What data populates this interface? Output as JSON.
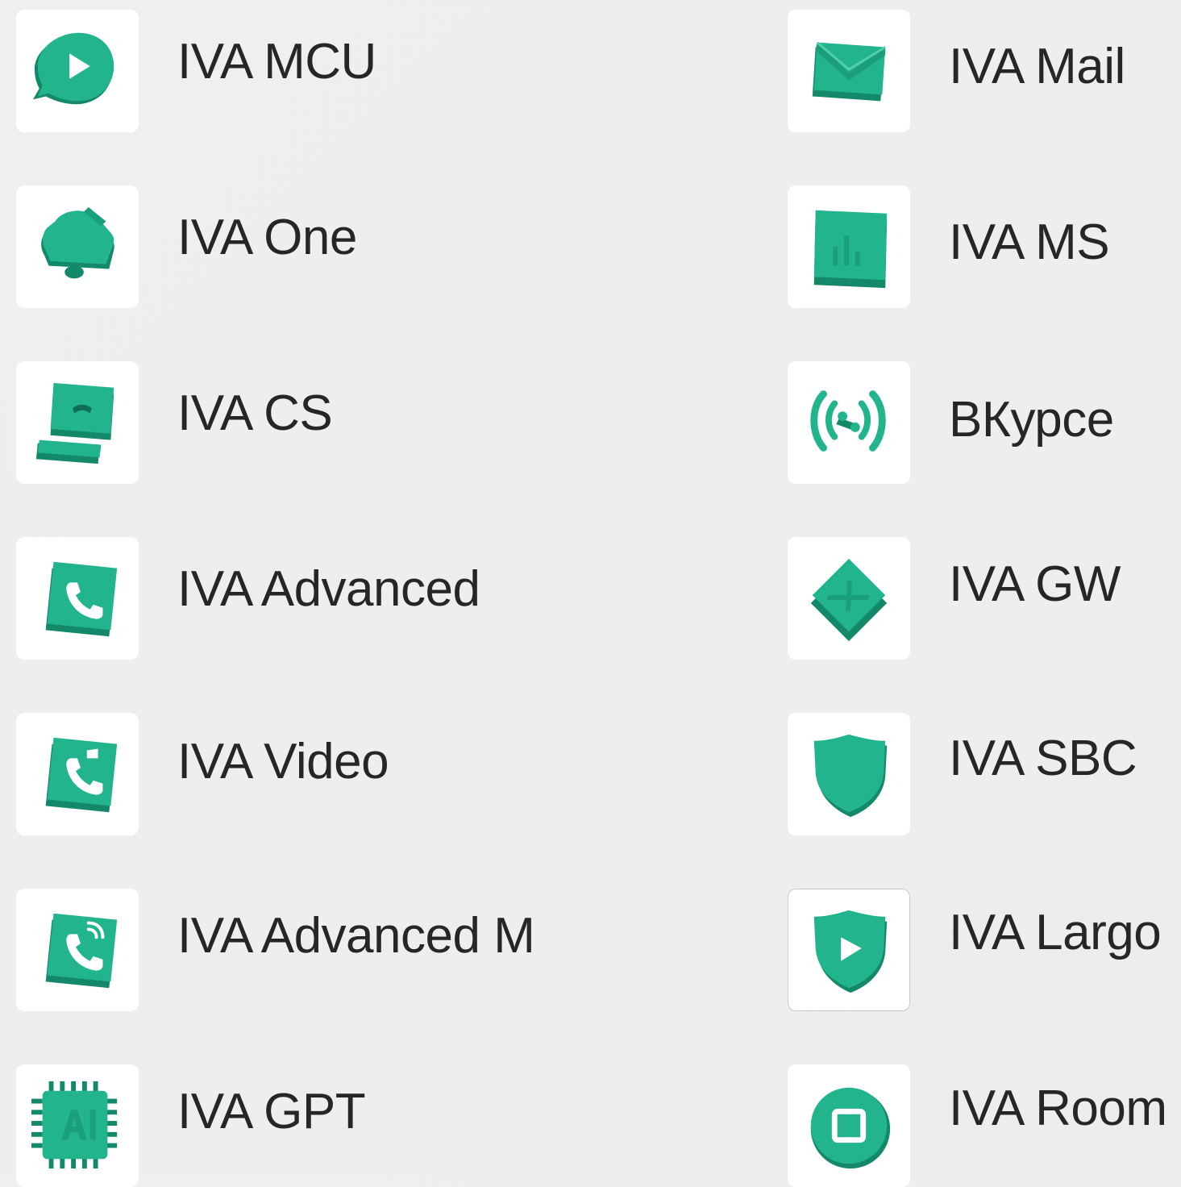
{
  "accent_color": "#22b48c",
  "accent_dark": "#14896a",
  "tile_color": "#ffffff",
  "text_color": "#262626",
  "products": [
    {
      "id": "mcu",
      "label": "IVA MCU",
      "icon": "chat-play-icon"
    },
    {
      "id": "mail",
      "label": "IVA Mail",
      "icon": "envelope-icon"
    },
    {
      "id": "one",
      "label": "IVA One",
      "icon": "bell-icon"
    },
    {
      "id": "ms",
      "label": "IVA MS",
      "icon": "bar-chart-icon"
    },
    {
      "id": "cs",
      "label": "IVA CS",
      "icon": "phone-handset-tray-icon"
    },
    {
      "id": "vkurse",
      "label": "ВКурсе",
      "icon": "broadcast-icon"
    },
    {
      "id": "advanced",
      "label": "IVA Advanced",
      "icon": "phone-square-icon"
    },
    {
      "id": "gw",
      "label": "IVA GW",
      "icon": "diamond-divider-icon"
    },
    {
      "id": "video",
      "label": "IVA Video",
      "icon": "phone-video-square-icon"
    },
    {
      "id": "sbc",
      "label": "IVA SBC",
      "icon": "shield-icon"
    },
    {
      "id": "advanced-m",
      "label": "IVA Advanced M",
      "icon": "phone-signal-square-icon"
    },
    {
      "id": "largo",
      "label": "IVA Largo",
      "icon": "shield-play-icon"
    },
    {
      "id": "gpt",
      "label": "IVA GPT",
      "icon": "ai-chip-icon"
    },
    {
      "id": "room",
      "label": "IVA Room",
      "icon": "circle-square-icon"
    }
  ]
}
